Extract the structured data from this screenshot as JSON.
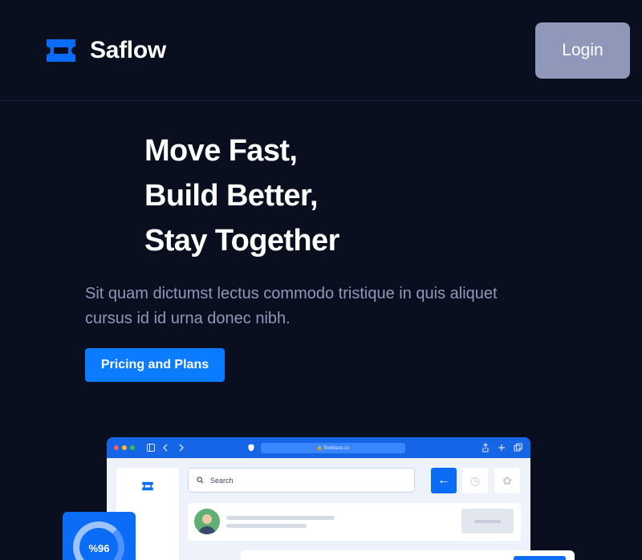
{
  "brand": {
    "name": "Saflow",
    "accent": "#0b6cf5"
  },
  "nav": {
    "login_label": "Login"
  },
  "hero": {
    "title_lines": [
      "Move Fast,",
      "Build Better,",
      "Stay Together"
    ],
    "subtitle": "Sit quam dictumst lectus commodo tristique in quis aliquet cursus id id urna donec nibh.",
    "cta_label": "Pricing and Plans"
  },
  "mockup": {
    "url": "🔒 flowbase.co",
    "search_placeholder": "Search",
    "stat_value": "%96",
    "icons": [
      "logo-icon",
      "search-icon",
      "arrow-left-icon",
      "clock-icon",
      "leaf-icon",
      "share-icon",
      "plus-icon",
      "copy-icon",
      "sidebar-icon"
    ]
  },
  "colors": {
    "background": "#0a0f1f",
    "login_button": "#8f98b8",
    "cta": "#0b7bff",
    "subtitle": "#8f98b8"
  }
}
